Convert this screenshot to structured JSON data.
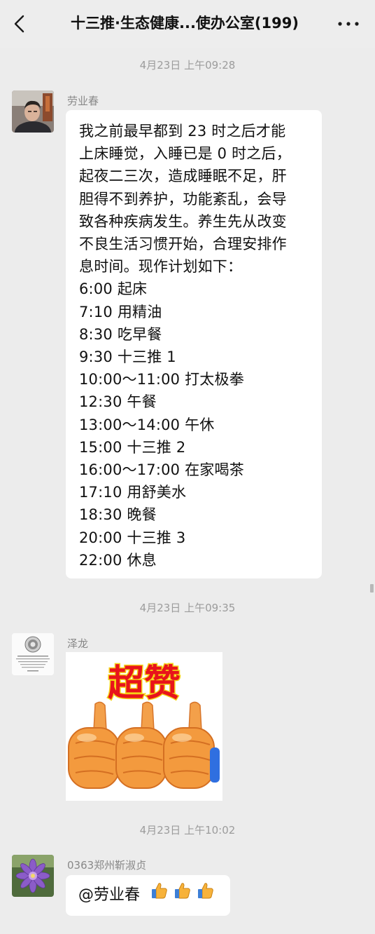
{
  "header": {
    "title": "十三推·生态健康...使办公室(199)",
    "back_icon": "chevron-left-icon",
    "more_icon": "ellipsis-icon"
  },
  "messages": [
    {
      "timestamp": "4月23日 上午09:28",
      "sender": "劳业春",
      "avatar": "man-photo-avatar",
      "lines": [
        "我之前最早都到 23 时之后才能",
        "上床睡觉，入睡已是 0 时之后，",
        "起夜二三次，造成睡眠不足，肝",
        "胆得不到养护，功能紊乱，会导",
        "致各种疾病发生。养生先从改变",
        "不良生活习惯开始，合理安排作",
        "息时间。现作计划如下："
      ],
      "schedule": [
        "6:00 起床",
        "7:10 用精油",
        "8:30 吃早餐",
        "9:30 十三推 1",
        "10:00～11:00 打太极拳",
        "12:30 午餐",
        "13:00～14:00 午休",
        "15:00 十三推 2",
        "16:00～17:00 在家喝茶",
        "17:10 用舒美水",
        "18:30 晚餐",
        "20:00 十三推 3",
        "22:00 休息"
      ]
    },
    {
      "timestamp": "4月23日 上午09:35",
      "sender": "泽龙",
      "avatar": "seal-emblem-avatar",
      "sticker": {
        "text": "超赞",
        "icon": "three-thumbs-up-sticker"
      }
    },
    {
      "timestamp": "4月23日 上午10:02",
      "sender": "0363郑州靳淑贞",
      "avatar": "purple-flower-avatar",
      "text": "@劳业春",
      "emoji": "thumbs-up-icon"
    }
  ],
  "colors": {
    "background": "#ececec",
    "bubble": "#ffffff",
    "timestamp": "#9c9c9c",
    "sender": "#888888",
    "sticker_text": "#e8141b",
    "sticker_outline": "#f5d316",
    "thumb": "#f3a04a"
  }
}
